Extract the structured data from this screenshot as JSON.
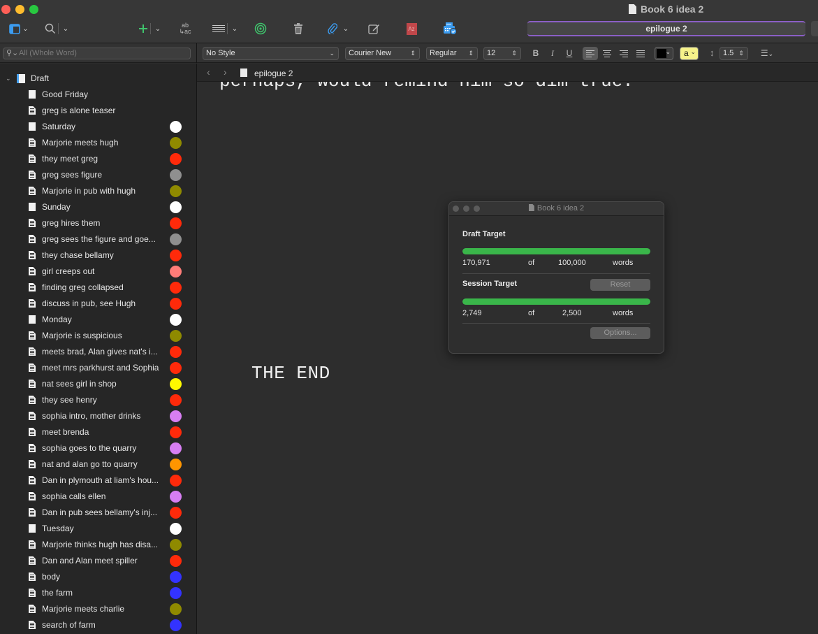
{
  "window": {
    "title": "Book 6 idea 2",
    "document_title_field": "epilogue 2"
  },
  "toolbar": {
    "items": [
      {
        "name": "view-layout",
        "icon": "sidebar-layout-icon"
      },
      {
        "name": "quick-search",
        "icon": "search-icon"
      },
      {
        "name": "add",
        "icon": "plus-icon"
      },
      {
        "name": "format",
        "icon": "ab-ac-icon",
        "glyph_top": "ab",
        "glyph_bottom": "↳ac"
      },
      {
        "name": "view-mode",
        "icon": "lines-icon"
      },
      {
        "name": "targets",
        "icon": "target-icon"
      },
      {
        "name": "trash",
        "icon": "trash-icon"
      },
      {
        "name": "attach",
        "icon": "paperclip-icon"
      },
      {
        "name": "edit",
        "icon": "compose-icon"
      },
      {
        "name": "dictionary",
        "icon": "az-book-icon",
        "glyph": "Az"
      },
      {
        "name": "compile",
        "icon": "compile-icon"
      }
    ]
  },
  "search": {
    "placeholder": "All (Whole Word)"
  },
  "format_bar": {
    "paragraph_style": "No Style",
    "font_family": "Courier New",
    "font_weight": "Regular",
    "font_size": "12",
    "bold": "B",
    "italic": "I",
    "underline": "U",
    "alignment_active": "left",
    "text_color": "#000000",
    "highlight_label": "a",
    "highlight_color": "#f6f28a",
    "line_spacing": "1.5"
  },
  "binder": {
    "root": {
      "label": "Draft"
    },
    "items": [
      {
        "label": "Good Friday",
        "type": "folder",
        "color": null
      },
      {
        "label": "greg is alone teaser",
        "type": "text",
        "color": null
      },
      {
        "label": "Saturday",
        "type": "folder",
        "color": "#ffffff"
      },
      {
        "label": "Marjorie meets hugh",
        "type": "text",
        "color": "#8f8a00"
      },
      {
        "label": "they meet greg",
        "type": "text",
        "color": "#ff2a0a"
      },
      {
        "label": "greg sees figure",
        "type": "text",
        "color": "#8f8f8f"
      },
      {
        "label": "Marjorie in pub with hugh",
        "type": "text",
        "color": "#8f8a00"
      },
      {
        "label": "Sunday",
        "type": "folder",
        "color": "#ffffff"
      },
      {
        "label": "greg hires them",
        "type": "text",
        "color": "#ff2a0a"
      },
      {
        "label": "greg sees the figure and goe...",
        "type": "text",
        "color": "#8f8f8f"
      },
      {
        "label": "they chase bellamy",
        "type": "text",
        "color": "#ff2a0a"
      },
      {
        "label": "girl creeps out",
        "type": "text",
        "color": "#ff7c78"
      },
      {
        "label": "finding greg collapsed",
        "type": "text",
        "color": "#ff2a0a"
      },
      {
        "label": "discuss in pub, see Hugh",
        "type": "text",
        "color": "#ff2a0a"
      },
      {
        "label": "Monday",
        "type": "folder",
        "color": "#ffffff"
      },
      {
        "label": "Marjorie is suspicious",
        "type": "text",
        "color": "#8f8a00"
      },
      {
        "label": "meets brad, Alan gives nat's i...",
        "type": "text",
        "color": "#ff2a0a"
      },
      {
        "label": "meet mrs parkhurst and Sophia",
        "type": "text",
        "color": "#ff2a0a"
      },
      {
        "label": "nat sees girl in shop",
        "type": "text",
        "color": "#fff800"
      },
      {
        "label": "they see henry",
        "type": "text",
        "color": "#ff2a0a"
      },
      {
        "label": "sophia intro, mother drinks",
        "type": "text",
        "color": "#d77ef2"
      },
      {
        "label": "meet brenda",
        "type": "text",
        "color": "#ff2a0a"
      },
      {
        "label": "sophia goes to the quarry",
        "type": "text",
        "color": "#d77ef2"
      },
      {
        "label": "nat and alan go tto quarry",
        "type": "text",
        "color": "#ff9500"
      },
      {
        "label": "Dan in plymouth at liam's hou...",
        "type": "text",
        "color": "#ff2a0a"
      },
      {
        "label": "sophia calls ellen",
        "type": "text",
        "color": "#d77ef2"
      },
      {
        "label": "Dan in pub sees bellamy's inj...",
        "type": "text",
        "color": "#ff2a0a"
      },
      {
        "label": "Tuesday",
        "type": "folder",
        "color": "#ffffff"
      },
      {
        "label": "Marjorie thinks hugh has disa...",
        "type": "text",
        "color": "#8f8a00"
      },
      {
        "label": "Dan and Alan meet spiller",
        "type": "text",
        "color": "#ff2a0a"
      },
      {
        "label": "body",
        "type": "text",
        "color": "#3333ff"
      },
      {
        "label": "the farm",
        "type": "text",
        "color": "#3333ff"
      },
      {
        "label": "Marjorie meets charlie",
        "type": "text",
        "color": "#8f8a00"
      },
      {
        "label": "search of farm",
        "type": "text",
        "color": "#3333ff"
      }
    ]
  },
  "editor": {
    "header_title": "epilogue 2",
    "clipped_line": "perhaps, would remind him so dim true.",
    "body_text": "THE END"
  },
  "targets_panel": {
    "title": "Book 6 idea 2",
    "draft": {
      "label": "Draft Target",
      "current": "170,971",
      "of": "of",
      "target": "100,000",
      "unit": "words",
      "progress_fraction": 1.0
    },
    "session": {
      "label": "Session Target",
      "reset_label": "Reset",
      "current": "2,749",
      "of": "of",
      "target": "2,500",
      "unit": "words",
      "progress_fraction": 1.0
    },
    "options_label": "Options..."
  }
}
